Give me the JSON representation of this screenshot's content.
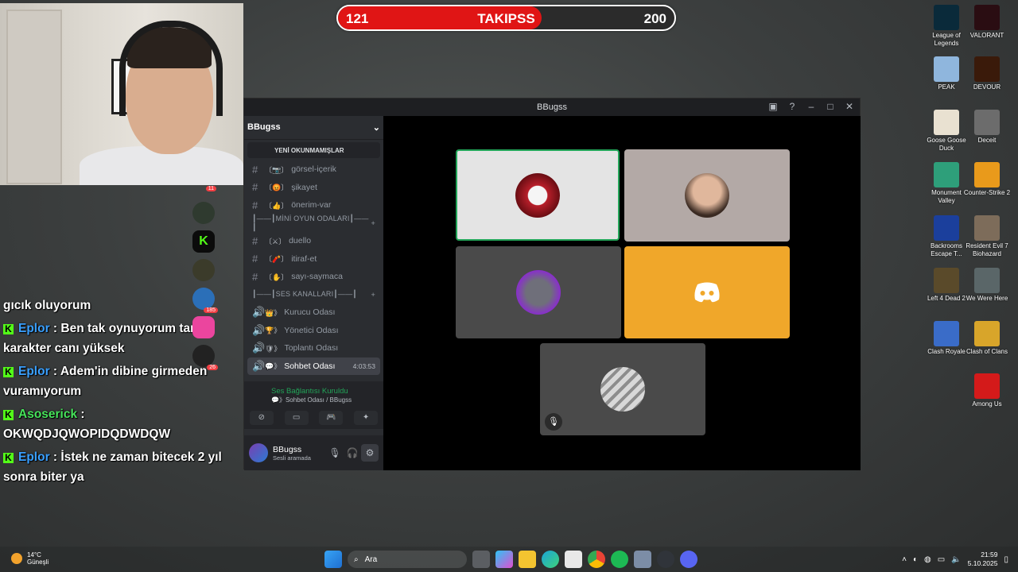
{
  "score_bar": {
    "current": "121",
    "title": "TAKIPSS",
    "target": "200",
    "progress": 0.605,
    "fill_color": "#e01515"
  },
  "chat": {
    "partial_line": "gıcık oluyorum",
    "messages": [
      {
        "user": "Eplor",
        "sep": " :",
        "text": " Ben tak oynuyorum tank karakter canı yüksek",
        "user_color": "#3aa0ff"
      },
      {
        "user": "Eplor",
        "sep": " :",
        "text": " Adem'in dibine girmeden vuramıyorum",
        "user_color": "#3aa0ff"
      },
      {
        "user": "Asoserick",
        "sep": " :",
        "text": " OKWQDJQWOPIDQDWDQW",
        "user_color": "#46e35a"
      },
      {
        "user": "Eplor",
        "sep": " :",
        "text": " İstek ne zaman bitecek 2 yıl sonra biter ya",
        "user_color": "#3aa0ff"
      }
    ],
    "platform_icon": "kick-icon"
  },
  "discord": {
    "window_title": "BBugss",
    "server_name": "BBugss",
    "new_unreads": "YENİ OKUNMAMIŞLAR",
    "channels": [
      {
        "kind": "text",
        "emoji": "〔📷〕",
        "name": "görsel-içerik"
      },
      {
        "kind": "text",
        "emoji": "〔😡〕",
        "name": "şikayet"
      },
      {
        "kind": "text",
        "emoji": "〔👍〕",
        "name": "önerim-var"
      }
    ],
    "mini_games_category": "┃——┃MİNİ OYUN ODALARI┃——┃",
    "mini_games": [
      {
        "kind": "text",
        "emoji": "〔⚔〕",
        "name": "duello"
      },
      {
        "kind": "text",
        "emoji": "〔🧨〕",
        "name": "itiraf-et"
      },
      {
        "kind": "text",
        "emoji": "〔✋〕",
        "name": "sayı-saymaca"
      }
    ],
    "voice_category": "┃——┃SES KANALLARI┃——┃",
    "voice_channels": [
      {
        "emoji": "👑》",
        "name": "Kurucu Odası"
      },
      {
        "emoji": "🏆》",
        "name": "Yönetici Odası"
      },
      {
        "emoji": "🛡》",
        "name": "Toplantı Odası"
      },
      {
        "emoji": "💬》",
        "name": "Sohbet Odası",
        "timer": "4:03:53",
        "active": true
      }
    ],
    "server_badges": [
      "11",
      "185",
      "26"
    ],
    "voice_status": "Ses Bağlantısı Kuruldu",
    "voice_channel_path": "💬》Sohbet Odası / BBugss",
    "user": {
      "name": "BBugss",
      "status": "Sesli aramada"
    }
  },
  "taskbar": {
    "weather_temp": "14°C",
    "weather_label": "Güneşli",
    "search_placeholder": "Ara",
    "time": "21:59",
    "date": "5.10.2025"
  },
  "desktop_icons": [
    {
      "label": "League of Legends",
      "icon": "league-of-legends-icon",
      "color": "#0a2a3a"
    },
    {
      "label": "VALORANT",
      "icon": "valorant-icon",
      "color": "#2a0d12"
    },
    {
      "label": "PEAK",
      "icon": "peak-icon",
      "color": "#8fb6dd"
    },
    {
      "label": "DEVOUR",
      "icon": "devour-icon",
      "color": "#3a1a0a"
    },
    {
      "label": "Goose Goose Duck",
      "icon": "goose-goose-duck-icon",
      "color": "#e9e1d1"
    },
    {
      "label": "Deceit",
      "icon": "deceit-icon",
      "color": "#6c6c6c"
    },
    {
      "label": "Monument Valley",
      "icon": "monument-valley-icon",
      "color": "#2e9f7a"
    },
    {
      "label": "Counter-Strike 2",
      "icon": "counter-strike-2-icon",
      "color": "#e99a1b"
    },
    {
      "label": "Backrooms Escape T...",
      "icon": "backrooms-icon",
      "color": "#1b3f9c"
    },
    {
      "label": "Resident Evil 7 Biohazard",
      "icon": "resident-evil-icon",
      "color": "#7d6c5a"
    },
    {
      "label": "Left 4 Dead 2",
      "icon": "left-4-dead-2-icon",
      "color": "#5a4a2a"
    },
    {
      "label": "We Were Here",
      "icon": "we-were-here-icon",
      "color": "#5a6668"
    },
    {
      "label": "Clash Royale",
      "icon": "clash-royale-icon",
      "color": "#3a6cc8"
    },
    {
      "label": "Clash of Clans",
      "icon": "clash-of-clans-icon",
      "color": "#d8a52a"
    },
    {
      "label": "Among Us",
      "icon": "among-us-icon",
      "color": "#d41a1a"
    }
  ]
}
